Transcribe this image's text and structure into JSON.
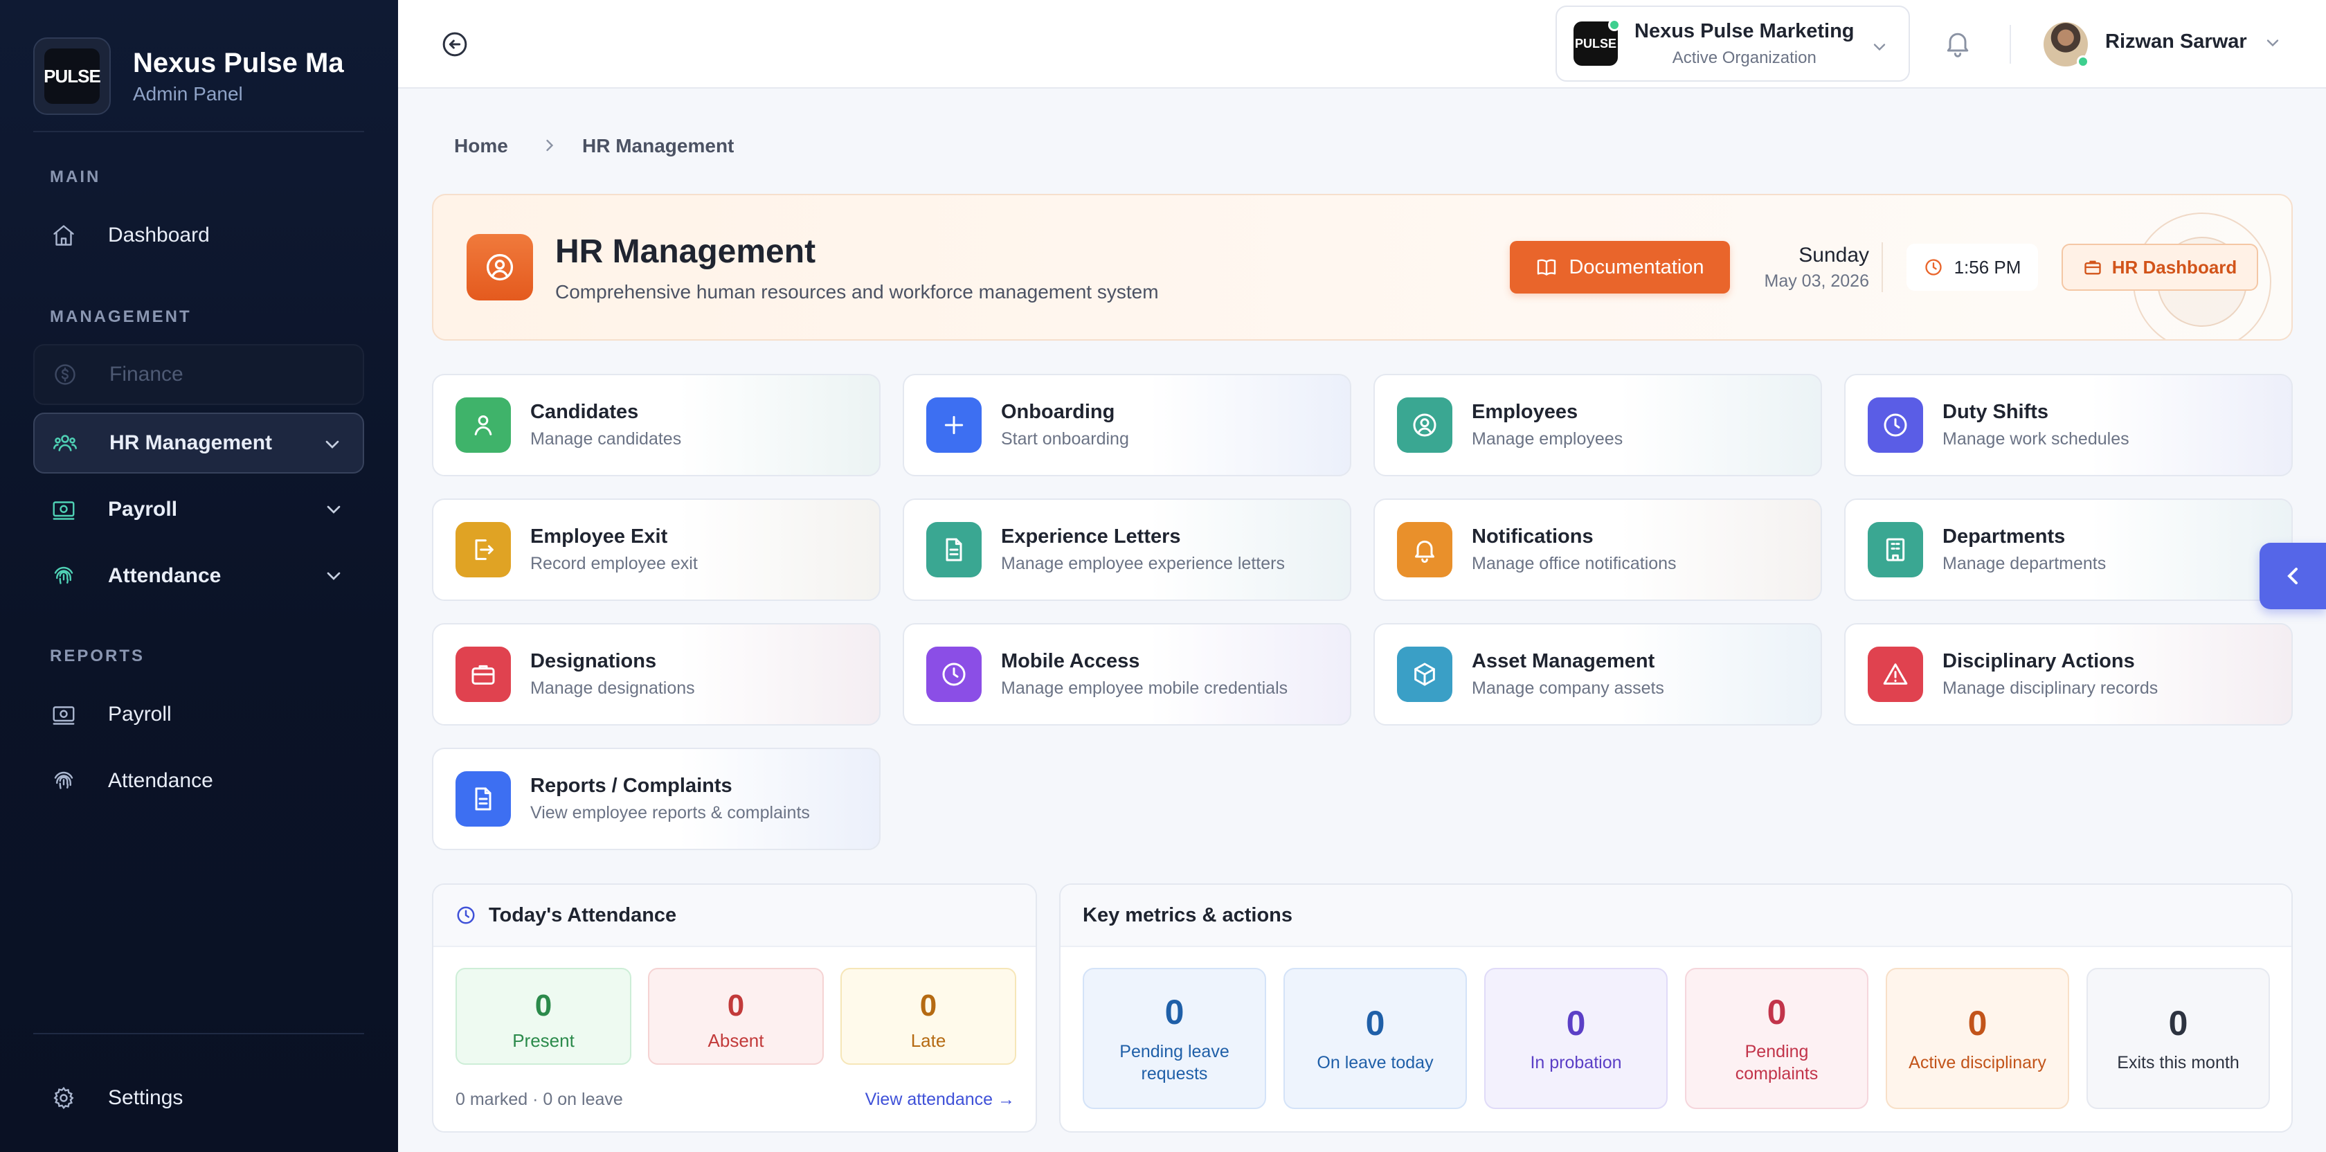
{
  "sidebar": {
    "brand_title": "Nexus Pulse Ma",
    "brand_sub": "Admin Panel",
    "logo_text": "PULSE",
    "section_main": "MAIN",
    "section_management": "MANAGEMENT",
    "section_reports": "REPORTS",
    "dashboard": "Dashboard",
    "finance": "Finance",
    "hr_management": "HR Management",
    "payroll": "Payroll",
    "attendance": "Attendance",
    "reports_payroll": "Payroll",
    "reports_attendance": "Attendance",
    "settings": "Settings"
  },
  "header": {
    "org_name": "Nexus Pulse Marketing",
    "org_sub": "Active Organization",
    "org_logo": "PULSE",
    "user_name": "Rizwan Sarwar"
  },
  "breadcrumb": {
    "home": "Home",
    "current": "HR Management"
  },
  "hero": {
    "title": "HR Management",
    "subtitle": "Comprehensive human resources and workforce management system",
    "doc_button": "Documentation",
    "day": "Sunday",
    "date": "May 03, 2026",
    "time": "1:56 PM",
    "dashboard_button": "HR Dashboard",
    "accent": "#e9652b"
  },
  "modules": [
    {
      "title": "Candidates",
      "sub": "Manage candidates",
      "icon": "user-icon",
      "color": "#3fb36a"
    },
    {
      "title": "Onboarding",
      "sub": "Start onboarding",
      "icon": "plus-icon",
      "color": "#3d6ff2"
    },
    {
      "title": "Employees",
      "sub": "Manage employees",
      "icon": "user-circle-icon",
      "color": "#3aa792"
    },
    {
      "title": "Duty Shifts",
      "sub": "Manage work schedules",
      "icon": "clock-icon",
      "color": "#5a5de6"
    },
    {
      "title": "Employee Exit",
      "sub": "Record employee exit",
      "icon": "exit-icon",
      "color": "#e0a324"
    },
    {
      "title": "Experience Letters",
      "sub": "Manage employee experience letters",
      "icon": "document-icon",
      "color": "#3aa792"
    },
    {
      "title": "Notifications",
      "sub": "Manage office notifications",
      "icon": "bell-icon",
      "color": "#e9902b"
    },
    {
      "title": "Departments",
      "sub": "Manage departments",
      "icon": "building-icon",
      "color": "#3aa792"
    },
    {
      "title": "Designations",
      "sub": "Manage designations",
      "icon": "briefcase-icon",
      "color": "#e0424f"
    },
    {
      "title": "Mobile Access",
      "sub": "Manage employee mobile credentials",
      "icon": "clock-icon",
      "color": "#8b4ee6"
    },
    {
      "title": "Asset Management",
      "sub": "Manage company assets",
      "icon": "box-icon",
      "color": "#3a9fc6"
    },
    {
      "title": "Disciplinary Actions",
      "sub": "Manage disciplinary records",
      "icon": "warning-icon",
      "color": "#e0424f"
    },
    {
      "title": "Reports / Complaints",
      "sub": "View employee reports & complaints",
      "icon": "document-icon",
      "color": "#3d6ff2"
    }
  ],
  "attendance": {
    "title": "Today's Attendance",
    "present": "0",
    "present_label": "Present",
    "absent": "0",
    "absent_label": "Absent",
    "late": "0",
    "late_label": "Late",
    "footer": "0 marked · 0 on leave",
    "link": "View attendance →"
  },
  "metrics": {
    "title": "Key metrics & actions",
    "items": [
      {
        "value": "0",
        "label": "Pending leave requests"
      },
      {
        "value": "0",
        "label": "On leave today"
      },
      {
        "value": "0",
        "label": "In probation"
      },
      {
        "value": "0",
        "label": "Pending complaints"
      },
      {
        "value": "0",
        "label": "Active disciplinary"
      },
      {
        "value": "0",
        "label": "Exits this month"
      }
    ]
  }
}
